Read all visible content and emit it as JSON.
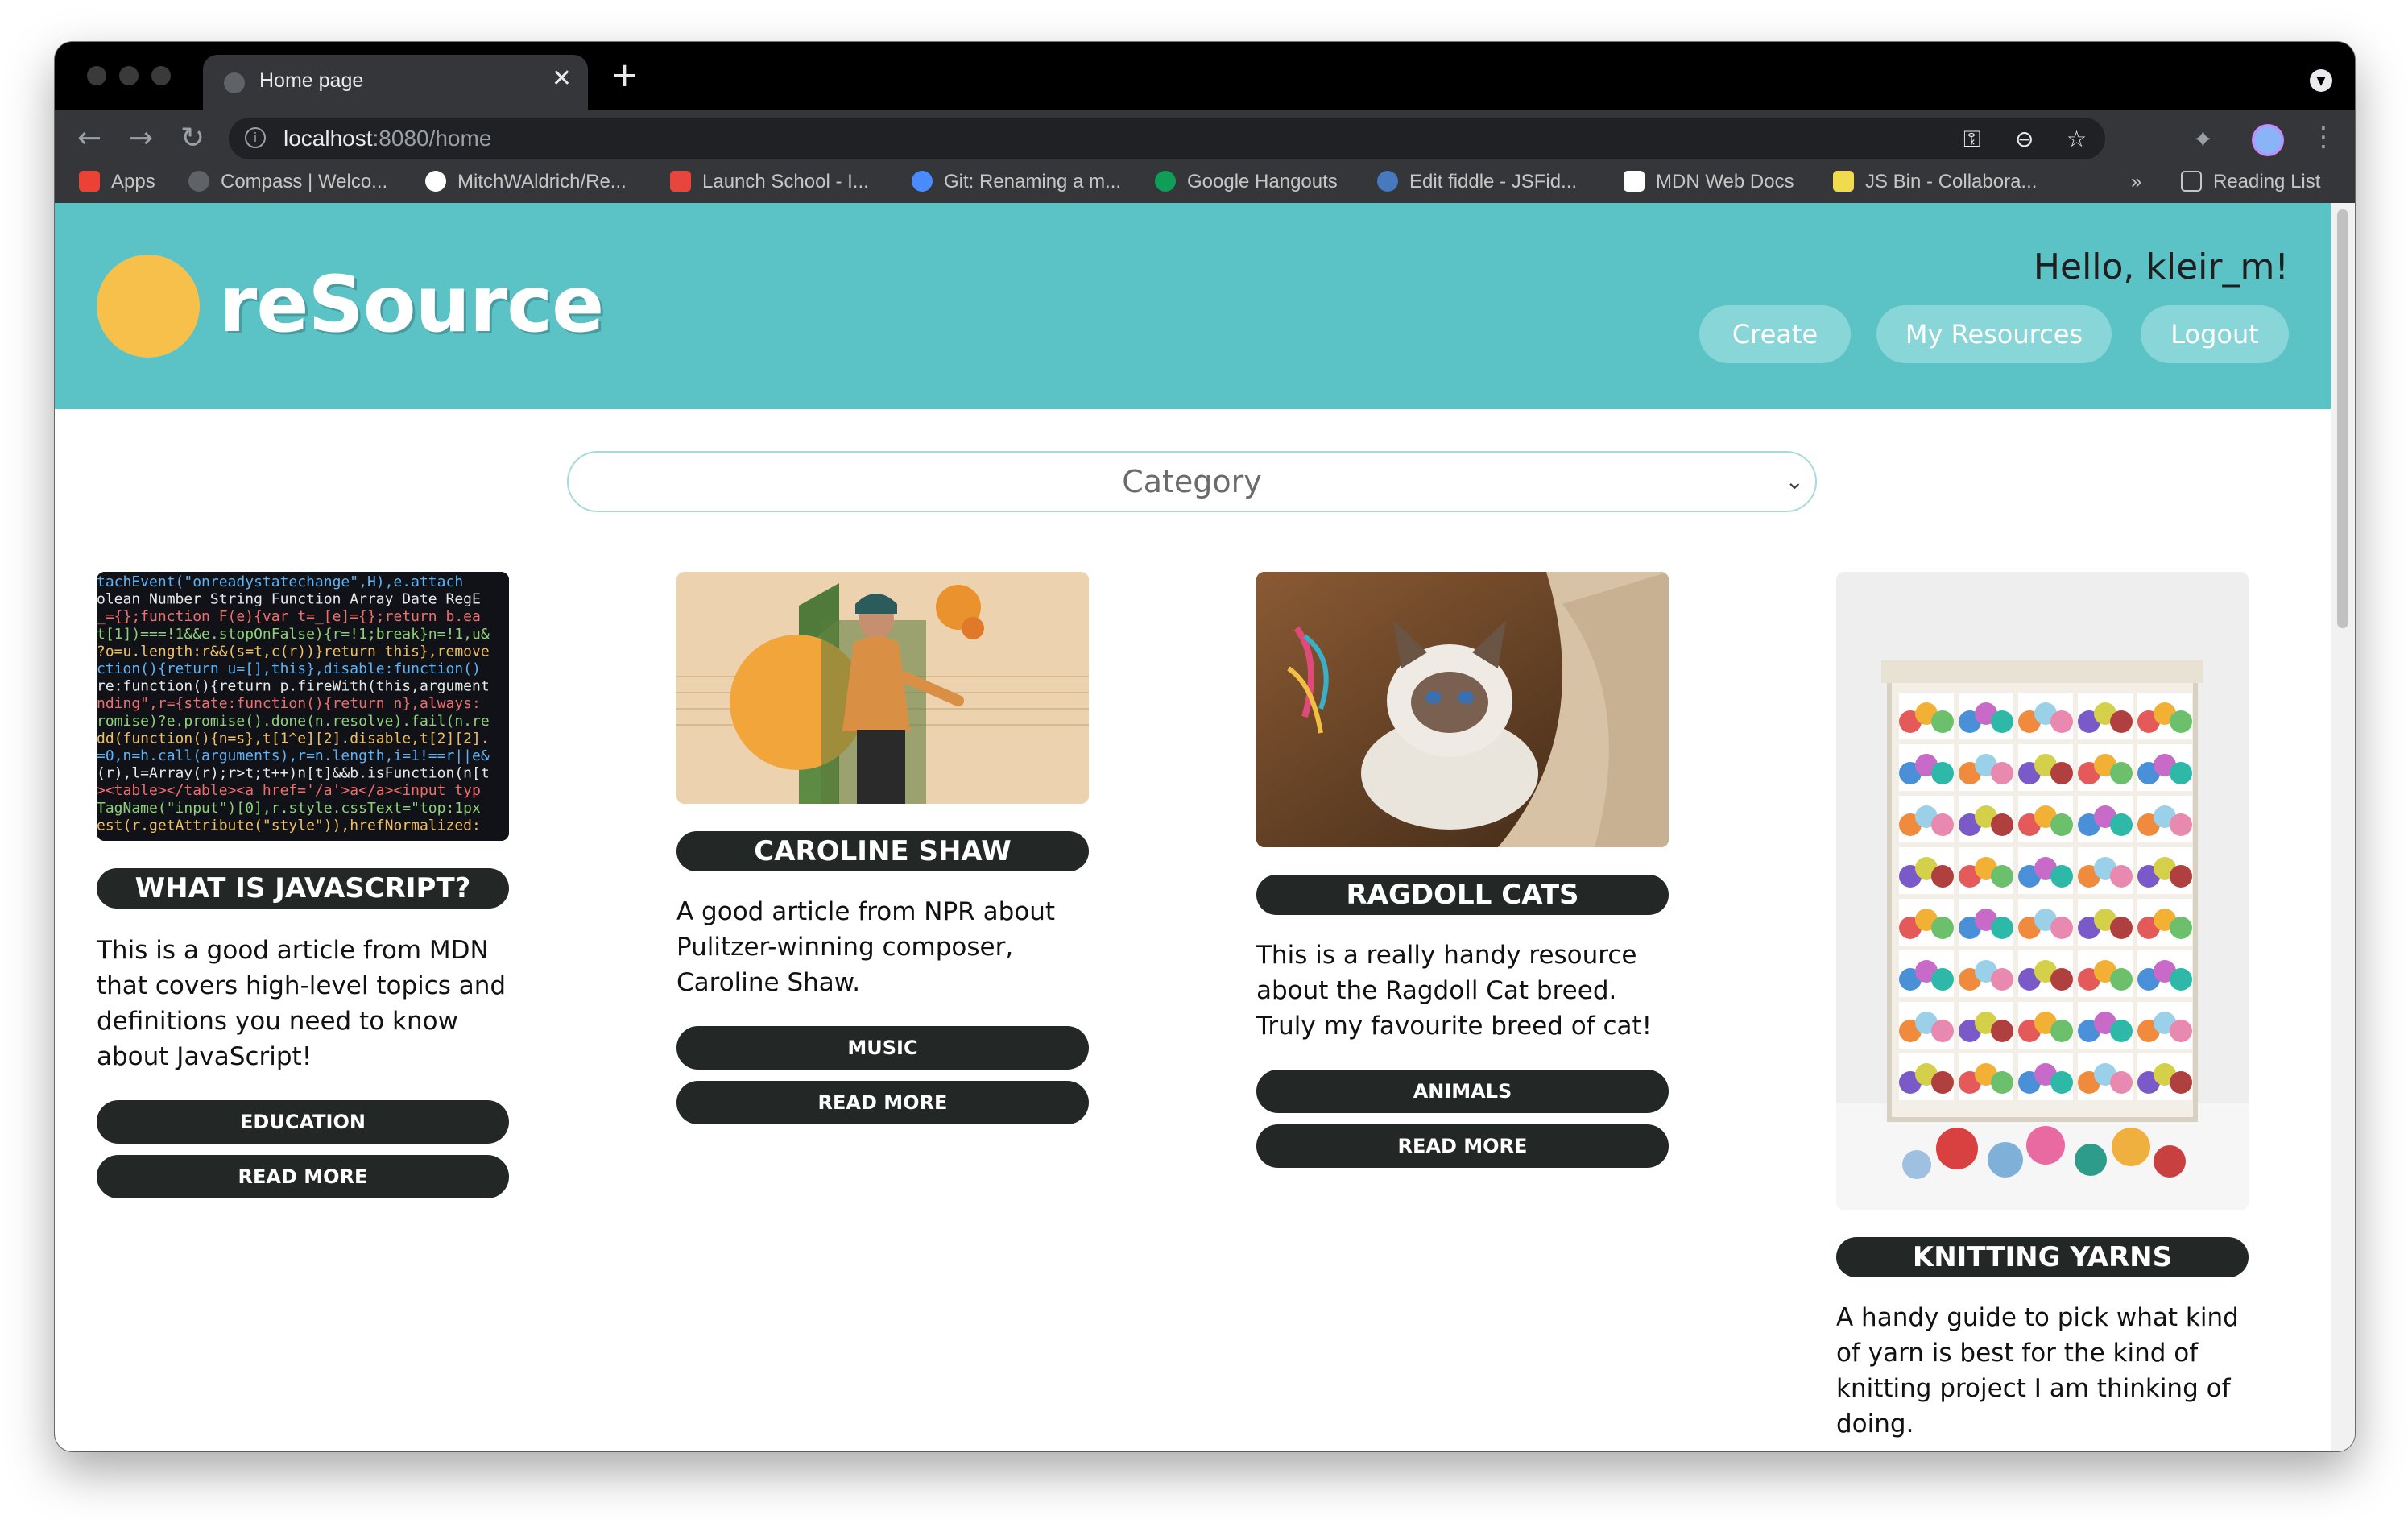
{
  "browser": {
    "tab_title": "Home page",
    "url_host": "localhost",
    "url_rest": ":8080/home",
    "bookmarks": [
      {
        "label": "Apps",
        "color": "#ea4335"
      },
      {
        "label": "Compass | Welco...",
        "color": "#5f6368"
      },
      {
        "label": "MitchWAldrich/Re...",
        "color": "#ffffff"
      },
      {
        "label": "Launch School - I...",
        "color": "#e8453c"
      },
      {
        "label": "Git: Renaming a m...",
        "color": "#4a8cff"
      },
      {
        "label": "Google Hangouts",
        "color": "#0f9d58"
      },
      {
        "label": "Edit fiddle - JSFid...",
        "color": "#4679bd"
      },
      {
        "label": "MDN Web Docs",
        "color": "#ffffff"
      },
      {
        "label": "JS Bin - Collabora...",
        "color": "#f0db4f"
      }
    ],
    "overflow": "»",
    "reading_list": "Reading List"
  },
  "site": {
    "logo": "reSource",
    "greeting": "Hello, kleir_m!",
    "nav": {
      "create": "Create",
      "my_resources": "My Resources",
      "logout": "Logout"
    },
    "category_placeholder": "Category"
  },
  "cards": [
    {
      "title": "WHAT IS JAVASCRIPT?",
      "description": "This is a good article from MDN that covers high-level topics and definitions you need to know about JavaScript!",
      "category": "EDUCATION",
      "read_more": "READ MORE"
    },
    {
      "title": "CAROLINE SHAW",
      "description": "A good article from NPR about Pulitzer-winning composer, Caroline Shaw.",
      "category": "MUSIC",
      "read_more": "READ MORE"
    },
    {
      "title": "RAGDOLL CATS",
      "description": "This is a really handy resource about the Ragdoll Cat breed. Truly my favourite breed of cat!",
      "category": "ANIMALS",
      "read_more": "READ MORE"
    },
    {
      "title": "KNITTING YARNS",
      "description": "A handy guide to pick what kind of yarn is best for the kind of knitting project I am thinking of doing."
    }
  ],
  "code_lines": [
    "tachEvent(\"onreadystatechange\",H),e.attach",
    "olean Number String Function Array Date RegE",
    "_={};function F(e){var t=_[e]={};return b.ea",
    "t[1])===!1&&e.stopOnFalse){r=!1;break}n=!1,u&",
    "?o=u.length:r&&(s=t,c(r))}return this},remove",
    "ction(){return u=[],this},disable:function()",
    "re:function(){return p.fireWith(this,argument",
    "nding\",r={state:function(){return n},always:",
    "romise)?e.promise().done(n.resolve).fail(n.re",
    "dd(function(){n=s},t[1^e][2].disable,t[2][2].",
    "=0,n=h.call(arguments),r=n.length,i=1!==r||e&",
    "(r),l=Array(r);r>t;t++)n[t]&&b.isFunction(n[t",
    "><table></table><a href='/a'>a</a><input typ",
    "TagName(\"input\")[0],r.style.cssText=\"top:1px",
    "est(r.getAttribute(\"style\")),hrefNormalized:"
  ]
}
